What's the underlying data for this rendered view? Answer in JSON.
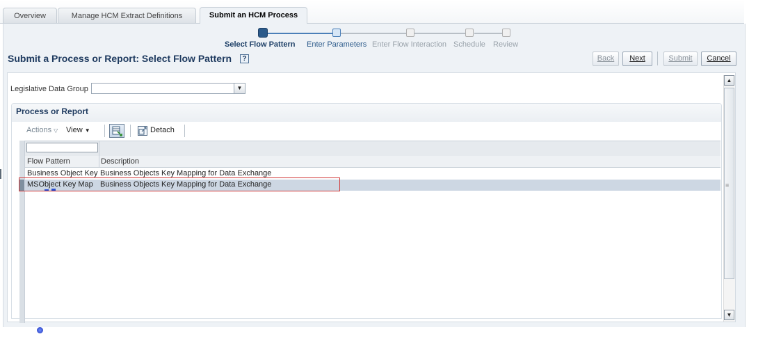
{
  "tabs": [
    {
      "label": "Overview"
    },
    {
      "label": "Manage HCM Extract Definitions"
    },
    {
      "label": "Submit an HCM Process"
    }
  ],
  "train": {
    "steps": [
      {
        "label": "Select Flow Pattern",
        "state": "current"
      },
      {
        "label": "Enter Parameters",
        "state": "visited"
      },
      {
        "label": "Enter Flow Interaction",
        "state": "future"
      },
      {
        "label": "Schedule",
        "state": "future"
      },
      {
        "label": "Review",
        "state": "future"
      }
    ]
  },
  "page": {
    "title": "Submit a Process or Report: Select Flow Pattern",
    "help_glyph": "?"
  },
  "buttons": {
    "back": "Back",
    "next": "Next",
    "submit": "Submit",
    "cancel": "Cancel"
  },
  "form": {
    "legislative_data_group_label": "Legislative Data Group",
    "legislative_data_group_value": ""
  },
  "section": {
    "title": "Process or Report"
  },
  "toolbar": {
    "actions": "Actions",
    "view": "View",
    "detach": "Detach"
  },
  "table": {
    "filter_value": "",
    "columns": [
      "Flow Pattern",
      "Description"
    ],
    "rows": [
      {
        "flow_pattern": "Business Object Key Map",
        "description": "Business Objects Key Mapping for Data Exchange",
        "selected": false
      },
      {
        "flow_pattern": "MSObject Key Map",
        "description": "Business Objects Key Mapping for Data Exchange",
        "selected": true
      }
    ]
  },
  "colors": {
    "accent": "#1e3a5f",
    "selection": "#cdd7e3",
    "highlight_border": "#d23a3a"
  }
}
